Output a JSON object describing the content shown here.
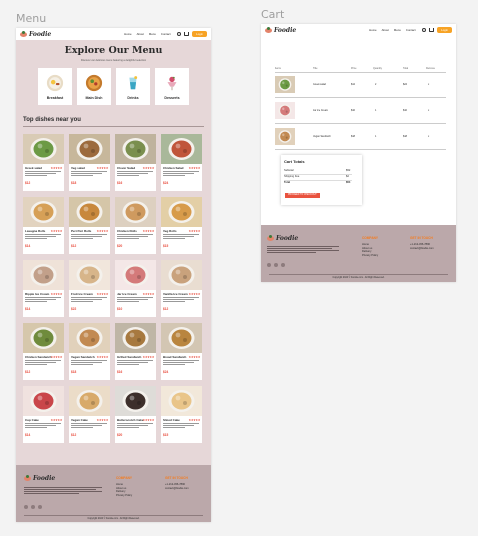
{
  "frames": {
    "menu_label": "Menu",
    "cart_label": "Cart"
  },
  "brand": {
    "name": "Foodie",
    "accent": "#f7a325",
    "price_color": "#e84b3c",
    "footer_bg": "#bba8aa",
    "menu_bg": "#e6d7d8"
  },
  "nav": {
    "links": [
      "Home",
      "About",
      "Menu",
      "Contact"
    ],
    "login_label": "Login"
  },
  "menu_page": {
    "title": "Explore Our Menu",
    "subtitle": "Discover our delicious menu featuring a delightful selection",
    "categories": [
      {
        "label": "Breakfast",
        "icon": "breakfast-plate-icon"
      },
      {
        "label": "Main Dish",
        "icon": "main-dish-bowl-icon"
      },
      {
        "label": "Drinks",
        "icon": "drink-glass-icon"
      },
      {
        "label": "Desserts",
        "icon": "dessert-cup-icon"
      }
    ],
    "section_title": "Top dishes near you",
    "rating": "★★★★★",
    "dishes": [
      {
        "name": "Greek salad",
        "price": "$12",
        "color": "#6c9a45",
        "bg": "#d9cbb5"
      },
      {
        "name": "Veg salad",
        "price": "$18",
        "color": "#9c6a3d",
        "bg": "#c7b79b"
      },
      {
        "name": "Clover Salad",
        "price": "$16",
        "color": "#7a8f4e",
        "bg": "#bfb39e"
      },
      {
        "name": "Chicken Salad",
        "price": "$24",
        "color": "#c0553a",
        "bg": "#a9b89a"
      },
      {
        "name": "Lasagna Rolls",
        "price": "$14",
        "color": "#d6a057",
        "bg": "#e2d3bf"
      },
      {
        "name": "Peri Peri Rolls",
        "price": "$12",
        "color": "#c8883d",
        "bg": "#d5c6a8"
      },
      {
        "name": "Chicken Rolls",
        "price": "$20",
        "color": "#cf9a5f",
        "bg": "#ddd0c0"
      },
      {
        "name": "Veg Rolls",
        "price": "$15",
        "color": "#d79b4a",
        "bg": "#e3cfa6"
      },
      {
        "name": "Ripple Ice Cream",
        "price": "$14",
        "color": "#c2a08a",
        "bg": "#efe2d8"
      },
      {
        "name": "Fruit Ice Cream",
        "price": "$22",
        "color": "#d7b58a",
        "bg": "#f1e6dc"
      },
      {
        "name": "Jar Ice Cream",
        "price": "$10",
        "color": "#d47a7a",
        "bg": "#f4e7e7"
      },
      {
        "name": "Vanilla Ice Cream",
        "price": "$12",
        "color": "#c9a27c",
        "bg": "#e9ddd1"
      },
      {
        "name": "Chicken Sandwich",
        "price": "$12",
        "color": "#6f8b3c",
        "bg": "#d6c7ab"
      },
      {
        "name": "Vegan Sandwich",
        "price": "$18",
        "color": "#c28a52",
        "bg": "#e1d1bb"
      },
      {
        "name": "Grilled Sandwich",
        "price": "$16",
        "color": "#a7793f",
        "bg": "#bfb6a6"
      },
      {
        "name": "Bread Sandwich",
        "price": "$24",
        "color": "#b9853f",
        "bg": "#d3c6b3"
      },
      {
        "name": "Cup Cake",
        "price": "$14",
        "color": "#c9464a",
        "bg": "#f0e2df"
      },
      {
        "name": "Vegan Cake",
        "price": "$12",
        "color": "#d8aa6a",
        "bg": "#ebdcc8"
      },
      {
        "name": "Butterscotch Cake",
        "price": "$20",
        "color": "#3d2f2b",
        "bg": "#dedcd8"
      },
      {
        "name": "Sliced Cake",
        "price": "$15",
        "color": "#e9c58a",
        "bg": "#f2e8da"
      }
    ]
  },
  "footer": {
    "company_heading": "COMPANY",
    "company_links": [
      "Home",
      "About us",
      "Delivery",
      "Privacy Policy"
    ],
    "contact_heading": "GET IN TOUCH",
    "phone": "+1-212-456-7890",
    "email": "contact@foodie.com",
    "copyright": "Copyright 2024 © Foodie.com - All Right Reserved."
  },
  "cart_page": {
    "headers": [
      "Items",
      "Title",
      "Price",
      "Quantity",
      "Total",
      "Remove"
    ],
    "items": [
      {
        "title": "Greek salad",
        "price": "$12",
        "quantity": "2",
        "total": "$24",
        "remove": "x",
        "color": "#6c9a45",
        "bg": "#d9cbb5"
      },
      {
        "title": "Jar Ice Cream",
        "price": "$10",
        "quantity": "1",
        "total": "$10",
        "remove": "x",
        "color": "#d47a7a",
        "bg": "#f4e7e7"
      },
      {
        "title": "Vegan Sandwich",
        "price": "$18",
        "quantity": "1",
        "total": "$18",
        "remove": "x",
        "color": "#c28a52",
        "bg": "#e1d1bb"
      }
    ],
    "totals_title": "Cart Totals",
    "subtotal_label": "Subtotal",
    "subtotal_value": "$52",
    "shipping_label": "Shipping Fee",
    "shipping_value": "$2",
    "total_label": "Total",
    "total_value": "$54",
    "checkout_label": "PROCEED TO CHECKOUT"
  }
}
